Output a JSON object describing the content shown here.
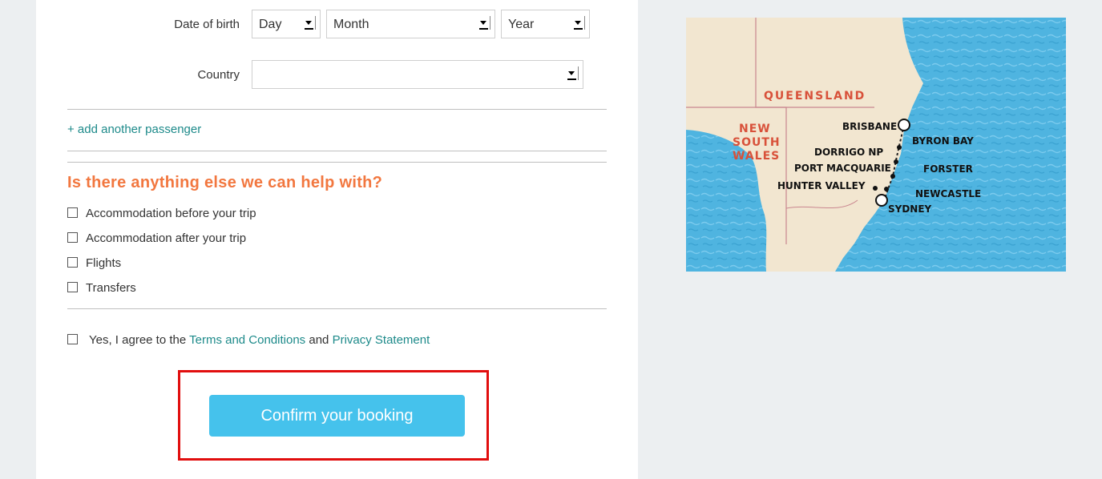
{
  "form": {
    "dob_label": "Date of birth",
    "dob_day": "Day",
    "dob_month": "Month",
    "dob_year": "Year",
    "country_label": "Country",
    "country_value": "",
    "add_passenger": "+ add another passenger",
    "help_heading": "Is there anything else we can help with?",
    "options": [
      "Accommodation before your trip",
      "Accommodation after your trip",
      "Flights",
      "Transfers"
    ],
    "agree_prefix": "Yes, I agree to the ",
    "terms_link": "Terms and Conditions",
    "agree_and": " and ",
    "privacy_link": "Privacy Statement",
    "confirm_button": "Confirm your booking"
  },
  "map": {
    "states": [
      "QUEENSLAND",
      "NEW",
      "SOUTH",
      "WALES"
    ],
    "places": [
      "BRISBANE",
      "BYRON BAY",
      "DORRIGO NP",
      "PORT MACQUARIE",
      "FORSTER",
      "HUNTER VALLEY",
      "NEWCASTLE",
      "SYDNEY"
    ]
  },
  "colors": {
    "accent_orange": "#f2773f",
    "link_teal": "#1d8a8a",
    "button_blue": "#45c2ec",
    "highlight_red": "#e10e0e",
    "sea": "#4fb4e0",
    "land": "#f2e6d0"
  }
}
